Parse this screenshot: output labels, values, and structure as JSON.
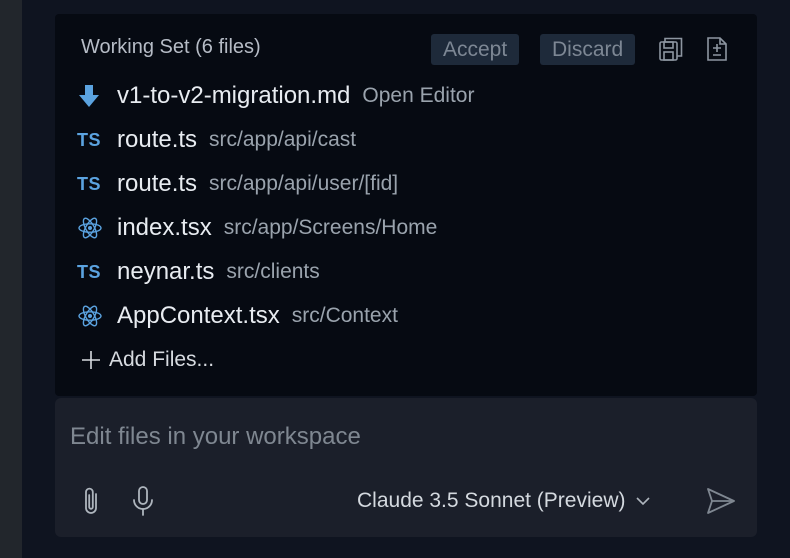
{
  "working_set": {
    "title": "Working Set (6 files)",
    "accept_label": "Accept",
    "discard_label": "Discard",
    "files": [
      {
        "icon": "download-arrow-icon",
        "name": "v1-to-v2-migration.md",
        "path": "Open Editor"
      },
      {
        "icon": "typescript-icon",
        "glyph": "TS",
        "name": "route.ts",
        "path": "src/app/api/cast"
      },
      {
        "icon": "typescript-icon",
        "glyph": "TS",
        "name": "route.ts",
        "path": "src/app/api/user/[fid]"
      },
      {
        "icon": "react-icon",
        "name": "index.tsx",
        "path": "src/app/Screens/Home"
      },
      {
        "icon": "typescript-icon",
        "glyph": "TS",
        "name": "neynar.ts",
        "path": "src/clients"
      },
      {
        "icon": "react-icon",
        "name": "AppContext.tsx",
        "path": "src/Context"
      }
    ],
    "add_files_label": "Add Files..."
  },
  "chat": {
    "placeholder": "Edit files in your workspace",
    "model": "Claude 3.5 Sonnet (Preview)"
  },
  "colors": {
    "accent_blue": "#5ba3e0",
    "panel_bg": "#060a12",
    "input_bg": "#1b1f2a"
  }
}
